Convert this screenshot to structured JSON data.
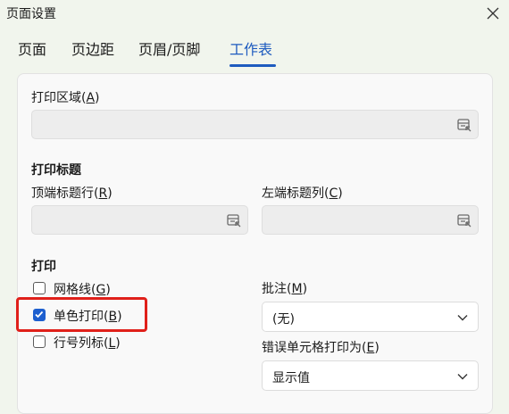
{
  "window": {
    "title": "页面设置"
  },
  "tabs": [
    {
      "label": "页面"
    },
    {
      "label": "页边距"
    },
    {
      "label": "页眉/页脚"
    },
    {
      "label": "工作表"
    }
  ],
  "print_area": {
    "label": "打印区域(",
    "key": "A",
    "suffix": ")",
    "value": ""
  },
  "print_titles": {
    "heading": "打印标题",
    "top_rows": {
      "label": "顶端标题行(",
      "key": "R",
      "suffix": ")",
      "value": ""
    },
    "left_cols": {
      "label": "左端标题列(",
      "key": "C",
      "suffix": ")",
      "value": ""
    }
  },
  "print": {
    "heading": "打印",
    "gridlines": {
      "label": "网格线(",
      "key": "G",
      "suffix": ")",
      "checked": false
    },
    "black_white": {
      "label": "单色打印(",
      "key": "B",
      "suffix": ")",
      "checked": true
    },
    "row_col_headings": {
      "label": "行号列标(",
      "key": "L",
      "suffix": ")",
      "checked": false
    },
    "comments": {
      "label": "批注(",
      "key": "M",
      "suffix": ")",
      "value": "(无)"
    },
    "errors": {
      "label": "错误单元格打印为(",
      "key": "E",
      "suffix": ")",
      "value": "显示值"
    }
  },
  "colors": {
    "accent": "#1e5bbf",
    "highlight": "#e0201a",
    "checkbox": "#1d5fcf"
  }
}
